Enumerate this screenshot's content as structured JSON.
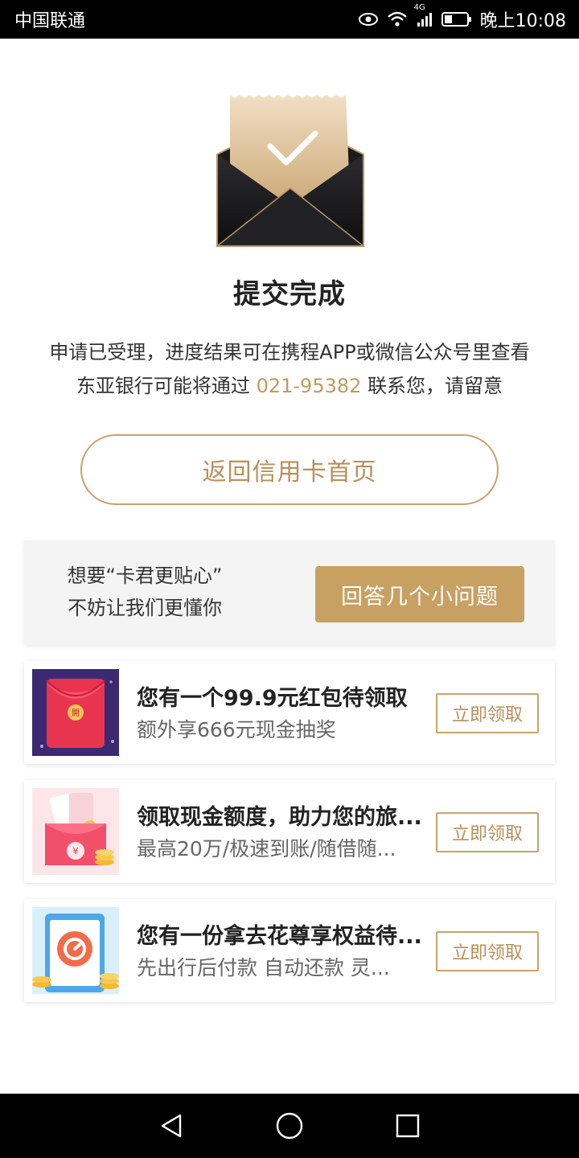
{
  "status_bar": {
    "carrier": "中国联通",
    "network": "4G",
    "time": "晚上10:08",
    "icons": [
      "eye-icon",
      "wifi-icon",
      "signal-icon",
      "battery-icon"
    ]
  },
  "success": {
    "title": "提交完成",
    "desc_line1": "申请已受理，进度结果可在携程APP或微信公众号里查看",
    "desc_line2_prefix": "东亚银行可能将通过 ",
    "phone": "021-95382",
    "desc_line2_suffix": " 联系您，请留意",
    "icon": "envelope-check-icon"
  },
  "home_button": {
    "label": "返回信用卡首页"
  },
  "survey": {
    "line1": "想要“卡君更贴心”",
    "line2": "不妨让我们更懂你",
    "button": "回答几个小问题"
  },
  "offers": [
    {
      "title": "您有一个99.9元红包待领取",
      "subtitle": "额外享666元现金抽奖",
      "button": "立即领取",
      "icon": "red-envelope-icon"
    },
    {
      "title": "领取现金额度，助力您的旅...",
      "subtitle": "最高20万/极速到账/随借随...",
      "button": "立即领取",
      "icon": "wallet-coins-icon"
    },
    {
      "title": "您有一份拿去花尊享权益待...",
      "subtitle": "先出行后付款 自动还款 灵...",
      "button": "立即领取",
      "icon": "phone-coins-icon"
    }
  ],
  "colors": {
    "accent_gold": "#c8a062",
    "gold_text": "#b8905a",
    "envelope_dark": "#1a1a1c"
  },
  "nav_bar": {
    "icons": [
      "back-icon",
      "home-icon",
      "recents-icon"
    ]
  }
}
